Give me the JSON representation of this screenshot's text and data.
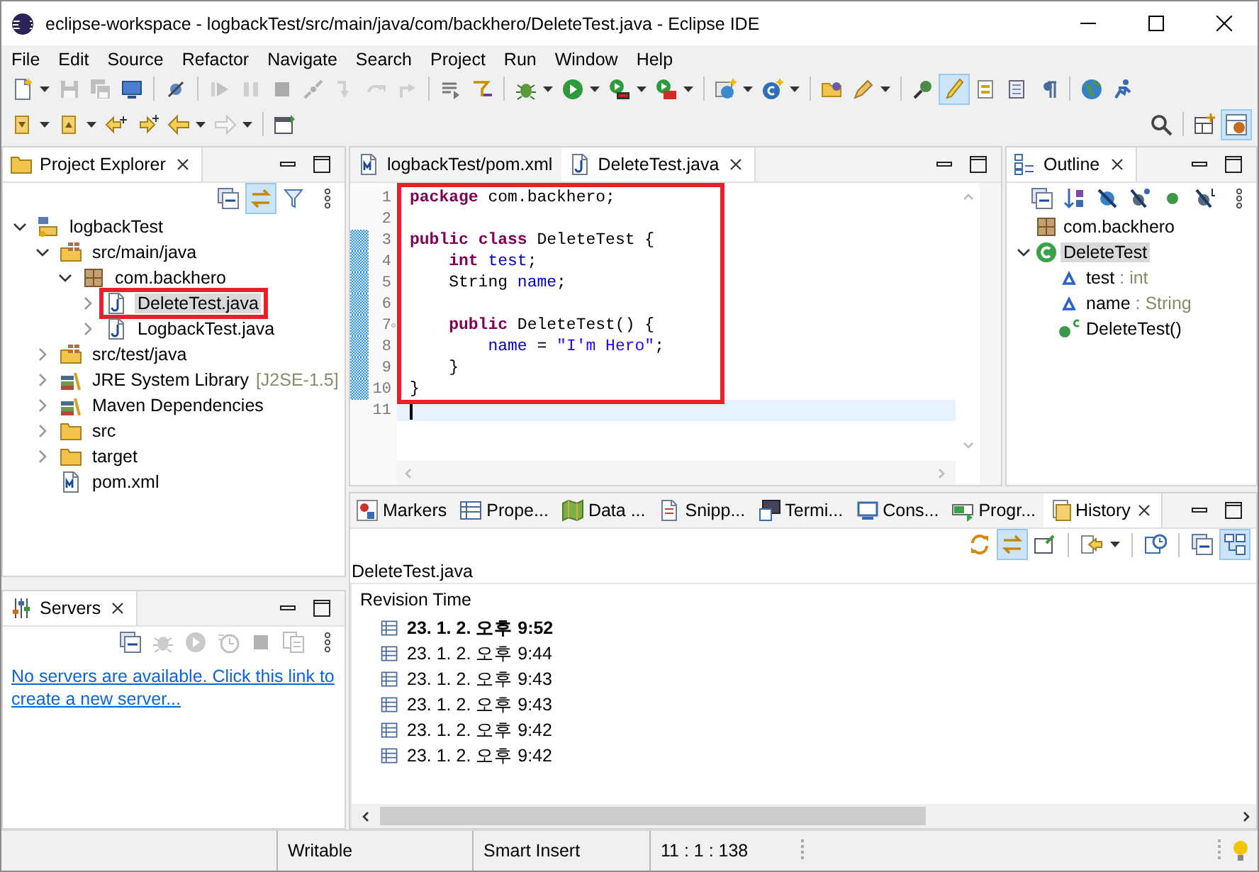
{
  "window": {
    "title": "eclipse-workspace - logbackTest/src/main/java/com/backhero/DeleteTest.java - Eclipse IDE"
  },
  "menu": [
    "File",
    "Edit",
    "Source",
    "Refactor",
    "Navigate",
    "Search",
    "Project",
    "Run",
    "Window",
    "Help"
  ],
  "main_toolbar": [
    {
      "disabled": false,
      "pressed": false
    },
    {
      "disabled": true,
      "pressed": false
    },
    {
      "disabled": true,
      "pressed": false
    },
    {
      "disabled": false,
      "pressed": false
    },
    {
      "disabled": false,
      "pressed": false
    },
    {
      "disabled": true,
      "pressed": false
    },
    {
      "disabled": true,
      "pressed": false
    },
    {
      "disabled": true,
      "pressed": false
    },
    {
      "disabled": true,
      "pressed": false
    },
    {
      "disabled": true,
      "pressed": false
    },
    {
      "disabled": true,
      "pressed": false
    },
    {
      "disabled": true,
      "pressed": false
    },
    {
      "disabled": false,
      "pressed": false
    },
    {
      "disabled": false,
      "pressed": false
    },
    {
      "disabled": false,
      "pressed": false
    },
    {
      "disabled": false,
      "pressed": false
    },
    {
      "disabled": false,
      "pressed": false
    },
    {
      "disabled": false,
      "pressed": false
    },
    {
      "disabled": false,
      "pressed": false
    },
    {
      "disabled": false,
      "pressed": false
    },
    {
      "disabled": false,
      "pressed": false
    },
    {
      "disabled": false,
      "pressed": false
    },
    {
      "disabled": false,
      "pressed": false
    },
    {
      "disabled": false,
      "pressed": true
    },
    {
      "disabled": false,
      "pressed": false
    },
    {
      "disabled": false,
      "pressed": false
    },
    {
      "disabled": false,
      "pressed": false
    },
    {
      "disabled": false,
      "pressed": false
    },
    {
      "disabled": false,
      "pressed": false
    }
  ],
  "nav_toolbar": [
    {
      "disabled": false,
      "pressed": false
    },
    {
      "disabled": false,
      "pressed": false
    },
    {
      "disabled": false,
      "pressed": false
    },
    {
      "disabled": false,
      "pressed": false
    },
    {
      "disabled": false,
      "pressed": false
    },
    {
      "disabled": true,
      "pressed": false
    },
    {
      "disabled": false,
      "pressed": false
    }
  ],
  "perspective_bar": [
    {
      "pressed": false
    },
    {
      "pressed": true
    }
  ],
  "project_explorer": {
    "title": "Project Explorer",
    "toolbar": [
      {
        "pressed": false
      },
      {
        "pressed": true
      },
      {
        "pressed": false
      }
    ],
    "tree": [
      {
        "label": "logbackTest",
        "kind": "project",
        "expanded": true,
        "selected": false,
        "annotated": false,
        "children": [
          {
            "label": "src/main/java",
            "kind": "source-folder",
            "expanded": true,
            "selected": false,
            "annotated": false,
            "children": [
              {
                "label": "com.backhero",
                "kind": "package",
                "expanded": true,
                "selected": false,
                "annotated": false,
                "children": [
                  {
                    "label": "DeleteTest.java",
                    "kind": "java-file",
                    "expanded": false,
                    "selected": true,
                    "annotated": true
                  },
                  {
                    "label": "LogbackTest.java",
                    "kind": "java-file",
                    "expanded": false,
                    "selected": false,
                    "annotated": false
                  }
                ]
              }
            ]
          },
          {
            "label": "src/test/java",
            "kind": "source-folder",
            "expanded": false,
            "selected": false,
            "annotated": false
          },
          {
            "label": "JRE System Library",
            "decoration": "[J2SE-1.5]",
            "kind": "library",
            "expanded": false,
            "selected": false,
            "annotated": false
          },
          {
            "label": "Maven Dependencies",
            "kind": "library",
            "expanded": false,
            "selected": false,
            "annotated": false
          },
          {
            "label": "src",
            "kind": "folder",
            "expanded": false,
            "selected": false,
            "annotated": false
          },
          {
            "label": "target",
            "kind": "folder",
            "expanded": false,
            "selected": false,
            "annotated": false
          },
          {
            "label": "pom.xml",
            "kind": "xml-file",
            "selected": false,
            "annotated": false
          }
        ]
      }
    ]
  },
  "editor": {
    "tabs": [
      {
        "label": "logbackTest/pom.xml",
        "kind": "xml-file",
        "selected": false
      },
      {
        "label": "DeleteTest.java",
        "kind": "java-file",
        "selected": true
      }
    ],
    "lines": [
      {
        "number": "1",
        "changed": false,
        "current": false,
        "foldable": false,
        "annotated": true,
        "tokens": [
          {
            "kind": "keyword",
            "text": "package"
          },
          {
            "kind": "plain",
            "text": " com.backhero;"
          }
        ]
      },
      {
        "number": "2",
        "changed": false,
        "current": false,
        "foldable": false,
        "annotated": true
      },
      {
        "number": "3",
        "changed": true,
        "current": false,
        "foldable": false,
        "annotated": true,
        "tokens": [
          {
            "kind": "keyword",
            "text": "public"
          },
          {
            "kind": "keyword",
            "text": " class"
          },
          {
            "kind": "plain",
            "text": " DeleteTest {"
          }
        ]
      },
      {
        "number": "4",
        "changed": true,
        "current": false,
        "foldable": false,
        "annotated": true,
        "tokens": [
          {
            "kind": "keyword",
            "text": "    int"
          },
          {
            "kind": "field",
            "text": " test"
          },
          {
            "kind": "plain",
            "text": ";"
          }
        ]
      },
      {
        "number": "5",
        "changed": true,
        "current": false,
        "foldable": false,
        "annotated": true,
        "tokens": [
          {
            "kind": "plain",
            "text": "    String "
          },
          {
            "kind": "field",
            "text": "name"
          },
          {
            "kind": "plain",
            "text": ";"
          }
        ]
      },
      {
        "number": "6",
        "changed": true,
        "current": false,
        "foldable": false,
        "annotated": true
      },
      {
        "number": "7",
        "changed": true,
        "current": false,
        "foldable": true,
        "annotated": true,
        "tokens": [
          {
            "kind": "keyword",
            "text": "    public"
          },
          {
            "kind": "plain",
            "text": " DeleteTest() {"
          }
        ]
      },
      {
        "number": "8",
        "changed": true,
        "current": false,
        "foldable": false,
        "annotated": true,
        "tokens": [
          {
            "kind": "field",
            "text": "        name"
          },
          {
            "kind": "plain",
            "text": " = "
          },
          {
            "kind": "string",
            "text": "\"I'm Hero\""
          },
          {
            "kind": "plain",
            "text": ";"
          }
        ]
      },
      {
        "number": "9",
        "changed": true,
        "current": false,
        "foldable": false,
        "annotated": true,
        "tokens": [
          {
            "kind": "plain",
            "text": "    }"
          }
        ]
      },
      {
        "number": "10",
        "changed": true,
        "current": false,
        "foldable": false,
        "annotated": true,
        "tokens": [
          {
            "kind": "plain",
            "text": "}"
          }
        ]
      },
      {
        "number": "11",
        "changed": false,
        "current": true,
        "foldable": false,
        "annotated": false
      }
    ]
  },
  "outline": {
    "title": "Outline",
    "tree": [
      {
        "label": "com.backhero",
        "kind": "package",
        "selected": false
      },
      {
        "label": "DeleteTest",
        "kind": "class",
        "expanded": true,
        "selected": true,
        "children": [
          {
            "label": "test",
            "type": " : int",
            "kind": "field",
            "selected": false
          },
          {
            "label": "name",
            "type": " : String",
            "kind": "field",
            "selected": false
          },
          {
            "label": "DeleteTest()",
            "kind": "constructor",
            "selected": false
          }
        ]
      }
    ]
  },
  "servers": {
    "title": "Servers",
    "toolbar": [
      {
        "disabled": false
      },
      {
        "disabled": true
      },
      {
        "disabled": true
      },
      {
        "disabled": true
      },
      {
        "disabled": true
      },
      {
        "disabled": true
      }
    ],
    "message": "No servers are available. Click this link to create a new server..."
  },
  "bottom_panel": {
    "tabs": [
      {
        "label": "Markers",
        "kind": "markers",
        "selected": false
      },
      {
        "label": "Prope...",
        "kind": "properties",
        "selected": false
      },
      {
        "label": "Data ...",
        "kind": "data",
        "selected": false
      },
      {
        "label": "Snipp...",
        "kind": "snippets",
        "selected": false
      },
      {
        "label": "Termi...",
        "kind": "terminal",
        "selected": false
      },
      {
        "label": "Cons...",
        "kind": "console",
        "selected": false
      },
      {
        "label": "Progr...",
        "kind": "progress",
        "selected": false
      },
      {
        "label": "History",
        "kind": "history",
        "selected": true
      }
    ],
    "toolbar": [
      {
        "pressed": false
      },
      {
        "pressed": true
      },
      {
        "pressed": false
      },
      {
        "pressed": false
      },
      {
        "pressed": false
      },
      {
        "pressed": false
      },
      {
        "pressed": true
      }
    ],
    "file": "DeleteTest.java",
    "columns": [
      "Revision Time"
    ],
    "revisions": [
      {
        "time": "23. 1. 2. 오후 9:52",
        "current": true
      },
      {
        "time": "23. 1. 2. 오후 9:44",
        "current": false
      },
      {
        "time": "23. 1. 2. 오후 9:43",
        "current": false
      },
      {
        "time": "23. 1. 2. 오후 9:43",
        "current": false
      },
      {
        "time": "23. 1. 2. 오후 9:42",
        "current": false
      },
      {
        "time": "23. 1. 2. 오후 9:42",
        "current": false
      }
    ]
  },
  "status_bar": {
    "fields": [
      "Writable",
      "Smart Insert",
      "11 : 1 : 138"
    ]
  }
}
